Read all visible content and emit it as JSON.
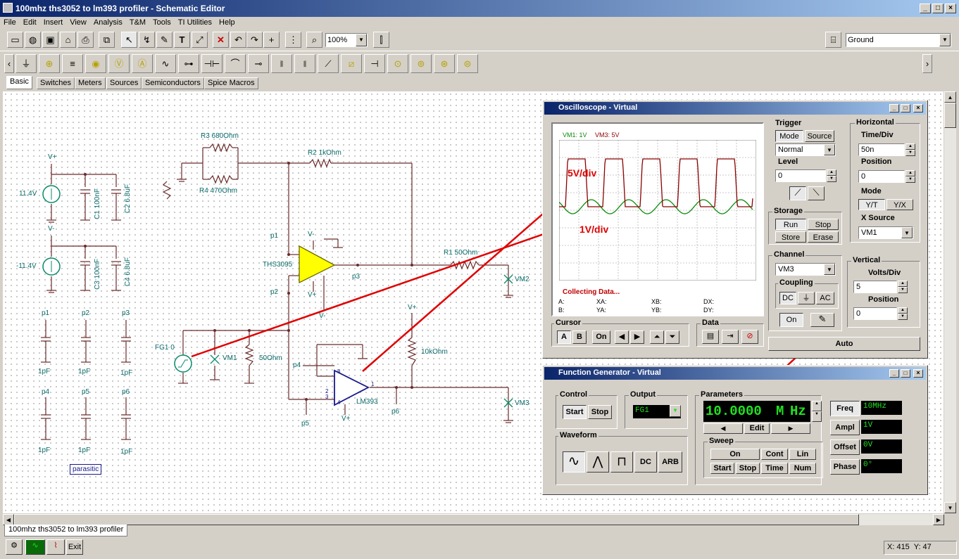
{
  "window": {
    "title": "100mhz ths3052 to lm393 profiler - Schematic Editor"
  },
  "menu": [
    "File",
    "Edit",
    "Insert",
    "View",
    "Analysis",
    "T&M",
    "Tools",
    "TI Utilities",
    "Help"
  ],
  "toolbar": {
    "zoom": "100%",
    "ground_select": "Ground"
  },
  "tabs": [
    "Basic",
    "Switches",
    "Meters",
    "Sources",
    "Semiconductors",
    "Spice Macros"
  ],
  "schematic": {
    "labels": {
      "vplus1": "V+",
      "v114": "11.4V",
      "c1": "C1 100nF",
      "c2": "C2 6.8uF",
      "vminus1": "V-",
      "vm114": "-11.4V",
      "c3": "C3 100nF",
      "c4": "C4 6.8uF",
      "r3": "R3 680Ohm",
      "r4": "R4 470Ohm",
      "r2": "R2 1kOhm",
      "r1": "R1 50Ohm",
      "p1": "p1",
      "p2": "p2",
      "p3": "p3",
      "p4": "p4",
      "p5": "p5",
      "p6": "p6",
      "ths": "THS3095",
      "vminus2": "V-",
      "vplus2": "V+",
      "vminus3": "V-",
      "vplus3": "V+",
      "vplus4": "V+",
      "lm": "LM393",
      "fg": "FG1 0",
      "vm1": "VM1",
      "r50": "50Ohm",
      "r10k": "10kOhm",
      "vm2": "VM2",
      "vm3": "VM3",
      "pp1": "p1",
      "pp2": "p2",
      "pp3": "p3",
      "pp4": "p4",
      "pp5": "p5",
      "pp6": "p6",
      "pf": "1pF",
      "parasitic": "parasitic",
      "pin1": "1",
      "pin2": "2",
      "pin3": "3",
      "pin4": "4",
      "pin8": "8"
    }
  },
  "oscilloscope": {
    "title": "Oscilloscope - Virtual",
    "legend_vm1": "VM1: 1V",
    "legend_vm3": "VM3: 5V",
    "status": "Collecting Data...",
    "readouts": {
      "a": "A:",
      "b": "B:",
      "xa": "XA:",
      "ya": "YA:",
      "xb": "XB:",
      "yb": "YB:",
      "dx": "DX:",
      "dy": "DY:"
    },
    "trigger": {
      "label": "Trigger",
      "mode": "Mode",
      "source": "Source",
      "mode_value": "Normal",
      "level_label": "Level",
      "level": "0"
    },
    "storage": {
      "label": "Storage",
      "run": "Run",
      "stop": "Stop",
      "store": "Store",
      "erase": "Erase"
    },
    "horizontal": {
      "label": "Horizontal",
      "timediv_label": "Time/Div",
      "timediv": "50n",
      "position_label": "Position",
      "position": "0",
      "mode_label": "Mode",
      "yt": "Y/T",
      "yx": "Y/X",
      "xsource_label": "X Source",
      "xsource": "VM1"
    },
    "channel": {
      "label": "Channel",
      "value": "VM3",
      "coupling_label": "Coupling",
      "dc": "DC",
      "gnd": "⏚",
      "ac": "AC",
      "on": "On"
    },
    "vertical": {
      "label": "Vertical",
      "voltsdiv_label": "Volts/Div",
      "voltsdiv": "5",
      "position_label": "Position",
      "position": "0"
    },
    "cursor": {
      "label": "Cursor",
      "a": "A",
      "b": "B",
      "on": "On"
    },
    "data": {
      "label": "Data"
    },
    "auto": "Auto"
  },
  "annotations": {
    "five": "5V/div",
    "one": "1V/div"
  },
  "function_generator": {
    "title": "Function Generator - Virtual",
    "control": {
      "label": "Control",
      "start": "Start",
      "stop": "Stop"
    },
    "output": {
      "label": "Output",
      "value": "FG1"
    },
    "parameters": {
      "label": "Parameters",
      "value": "10.0000",
      "unit_m": "M",
      "unit_hz": "Hz",
      "edit": "Edit"
    },
    "sweep": {
      "label": "Sweep",
      "on": "On",
      "cont": "Cont",
      "lin": "Lin",
      "start": "Start",
      "stop": "Stop",
      "time": "Time",
      "num": "Num"
    },
    "waveform": {
      "label": "Waveform",
      "dc": "DC",
      "arb": "ARB"
    },
    "freq": {
      "label": "Freq",
      "value": "10MHz"
    },
    "ampl": {
      "label": "Ampl",
      "value": "1V"
    },
    "offset": {
      "label": "Offset",
      "value": "0V"
    },
    "phase": {
      "label": "Phase",
      "value": "0°"
    }
  },
  "bottom_tab": "100mhz ths3052 to lm393 profiler",
  "status": {
    "exit": "Exit",
    "coords": "X: 415  Y: 47"
  },
  "colors": {
    "wire": "#6a2a2a",
    "text": "#0a6a6a",
    "opamp1": "#ffff00",
    "opamp2": "#1a1a8a",
    "trace_vm3": "#8a0000",
    "trace_vm1": "#0a8a0a",
    "annotation": "#e00000"
  }
}
